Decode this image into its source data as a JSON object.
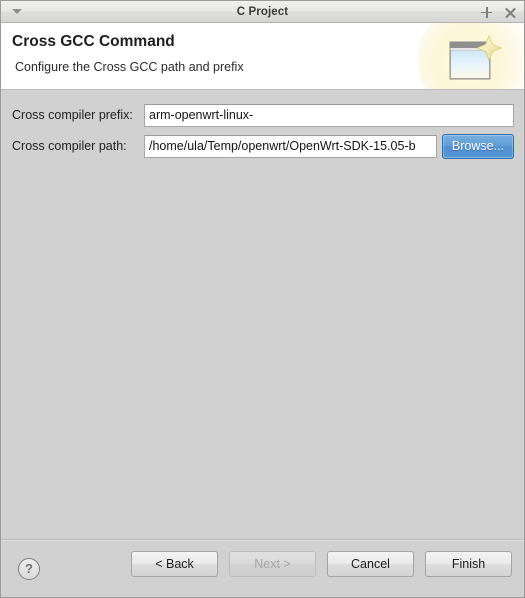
{
  "window": {
    "title": "C Project",
    "menu_icon": "chevron-down-icon",
    "maximize_icon": "plus-icon",
    "close_icon": "close-icon"
  },
  "banner": {
    "title": "Cross GCC Command",
    "subtitle": "Configure the Cross GCC path and prefix",
    "icon": "wizard-window-sparkle-icon"
  },
  "form": {
    "fields": [
      {
        "label": "Cross compiler prefix:",
        "value": "arm-openwrt-linux-",
        "placeholder": "",
        "name": "cross-compiler-prefix"
      },
      {
        "label": "Cross compiler path:",
        "value": "/home/ula/Temp/openwrt/OpenWrt-SDK-15.05-b",
        "placeholder": "",
        "name": "cross-compiler-path"
      }
    ],
    "browse_label": "Browse...",
    "browse_accent_color": "#5a99d4"
  },
  "footer": {
    "help_label": "?",
    "buttons": [
      {
        "label": "< Back",
        "name": "back-button",
        "disabled": false
      },
      {
        "label": "Next >",
        "name": "next-button",
        "disabled": true
      },
      {
        "label": "Cancel",
        "name": "cancel-button",
        "disabled": false
      },
      {
        "label": "Finish",
        "name": "finish-button",
        "disabled": false
      }
    ]
  }
}
